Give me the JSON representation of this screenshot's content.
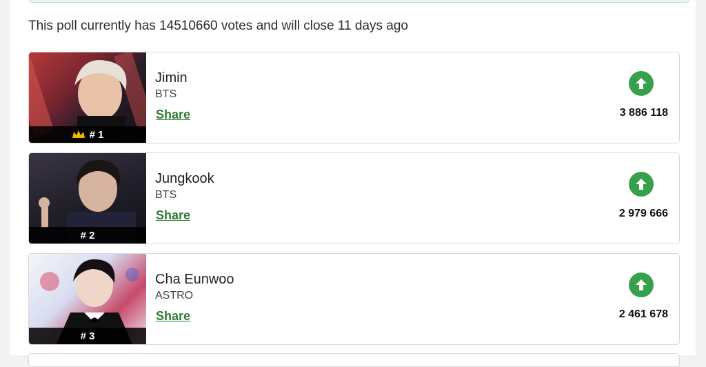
{
  "poll": {
    "info_text": "This poll currently has 14510660 votes and will close 11 days ago"
  },
  "candidates": [
    {
      "rank": "# 1",
      "name": "Jimin",
      "group": "BTS",
      "share_label": "Share",
      "votes": "3 886 118",
      "crown": true
    },
    {
      "rank": "# 2",
      "name": "Jungkook",
      "group": "BTS",
      "share_label": "Share",
      "votes": "2 979 666",
      "crown": false
    },
    {
      "rank": "# 3",
      "name": "Cha Eunwoo",
      "group": "ASTRO",
      "share_label": "Share",
      "votes": "2 461 678",
      "crown": false
    }
  ],
  "colors": {
    "accent_green": "#37a04a",
    "share_link": "#2f7d32",
    "crown_gold": "#f2b705"
  },
  "icons": {
    "vote": "arrow-up-circle-icon",
    "top_rank": "crown-icon"
  }
}
